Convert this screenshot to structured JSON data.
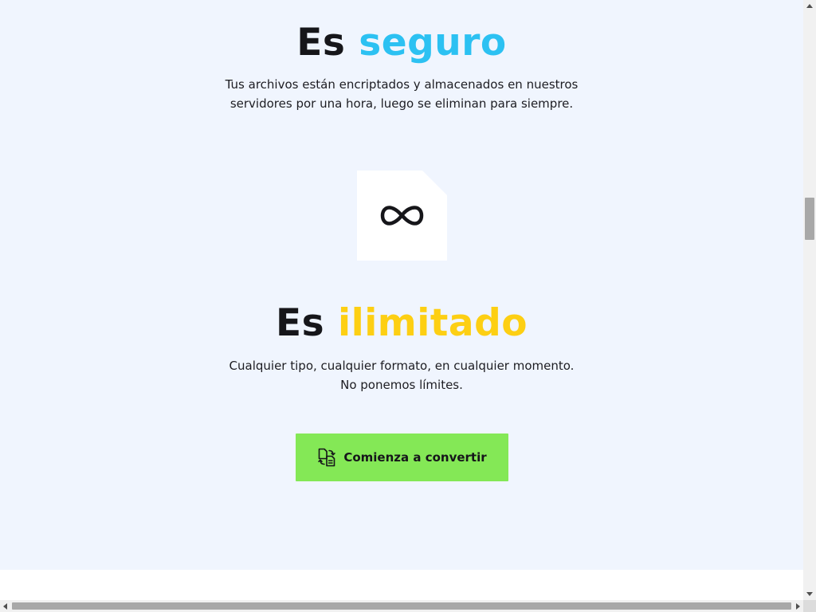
{
  "secure": {
    "heading_prefix": "Es",
    "heading_accent": "seguro",
    "accent_color": "#2cc1f2",
    "description_lines": [
      "Tus archivos están encriptados y almacenados en nuestros",
      "servidores por una hora, luego se eliminan para siempre."
    ]
  },
  "unlimited": {
    "icon": "infinity-icon",
    "heading_prefix": "Es",
    "heading_accent": "ilimitado",
    "accent_color": "#fdcf13",
    "description_lines": [
      "Cualquier tipo, cualquier formato, en cualquier momento.",
      "No ponemos límites."
    ]
  },
  "cta": {
    "label": "Comienza a convertir",
    "icon": "convert-files-icon",
    "color": "#84e856"
  },
  "colors": {
    "section_background": "#f0f5fe",
    "text": "#16161a"
  }
}
